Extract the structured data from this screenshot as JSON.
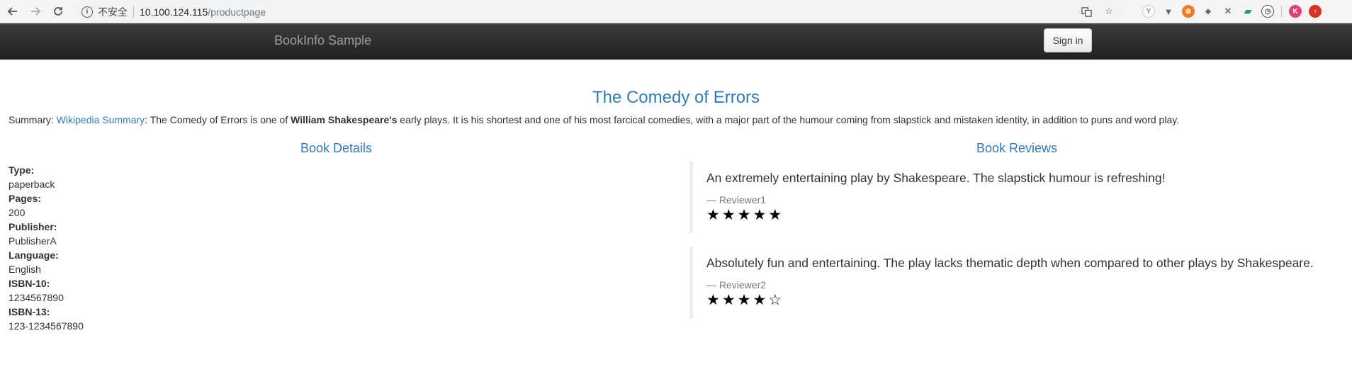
{
  "browser": {
    "security_label": "不安全",
    "url_host": "10.100.124.115",
    "url_path": "/productpage",
    "profile_initial": "K"
  },
  "navbar": {
    "brand": "BookInfo Sample",
    "signin_label": "Sign in"
  },
  "book": {
    "title": "The Comedy of Errors",
    "summary_prefix": "Summary: ",
    "summary_link": "Wikipedia Summary",
    "summary_mid": ": The Comedy of Errors is one of ",
    "summary_author": "William Shakespeare's",
    "summary_rest": " early plays. It is his shortest and one of his most farcical comedies, with a major part of the humour coming from slapstick and mistaken identity, in addition to puns and word play."
  },
  "details": {
    "heading": "Book Details",
    "items": [
      {
        "label": "Type:",
        "value": "paperback"
      },
      {
        "label": "Pages:",
        "value": "200"
      },
      {
        "label": "Publisher:",
        "value": "PublisherA"
      },
      {
        "label": "Language:",
        "value": "English"
      },
      {
        "label": "ISBN-10:",
        "value": "1234567890"
      },
      {
        "label": "ISBN-13:",
        "value": "123-1234567890"
      }
    ]
  },
  "reviews": {
    "heading": "Book Reviews",
    "items": [
      {
        "text": "An extremely entertaining play by Shakespeare. The slapstick humour is refreshing!",
        "reviewer": "— Reviewer1",
        "rating": 5,
        "stars": "★★★★★"
      },
      {
        "text": "Absolutely fun and entertaining. The play lacks thematic depth when compared to other plays by Shakespeare.",
        "reviewer": "— Reviewer2",
        "rating": 4,
        "stars": "★★★★☆"
      }
    ]
  }
}
